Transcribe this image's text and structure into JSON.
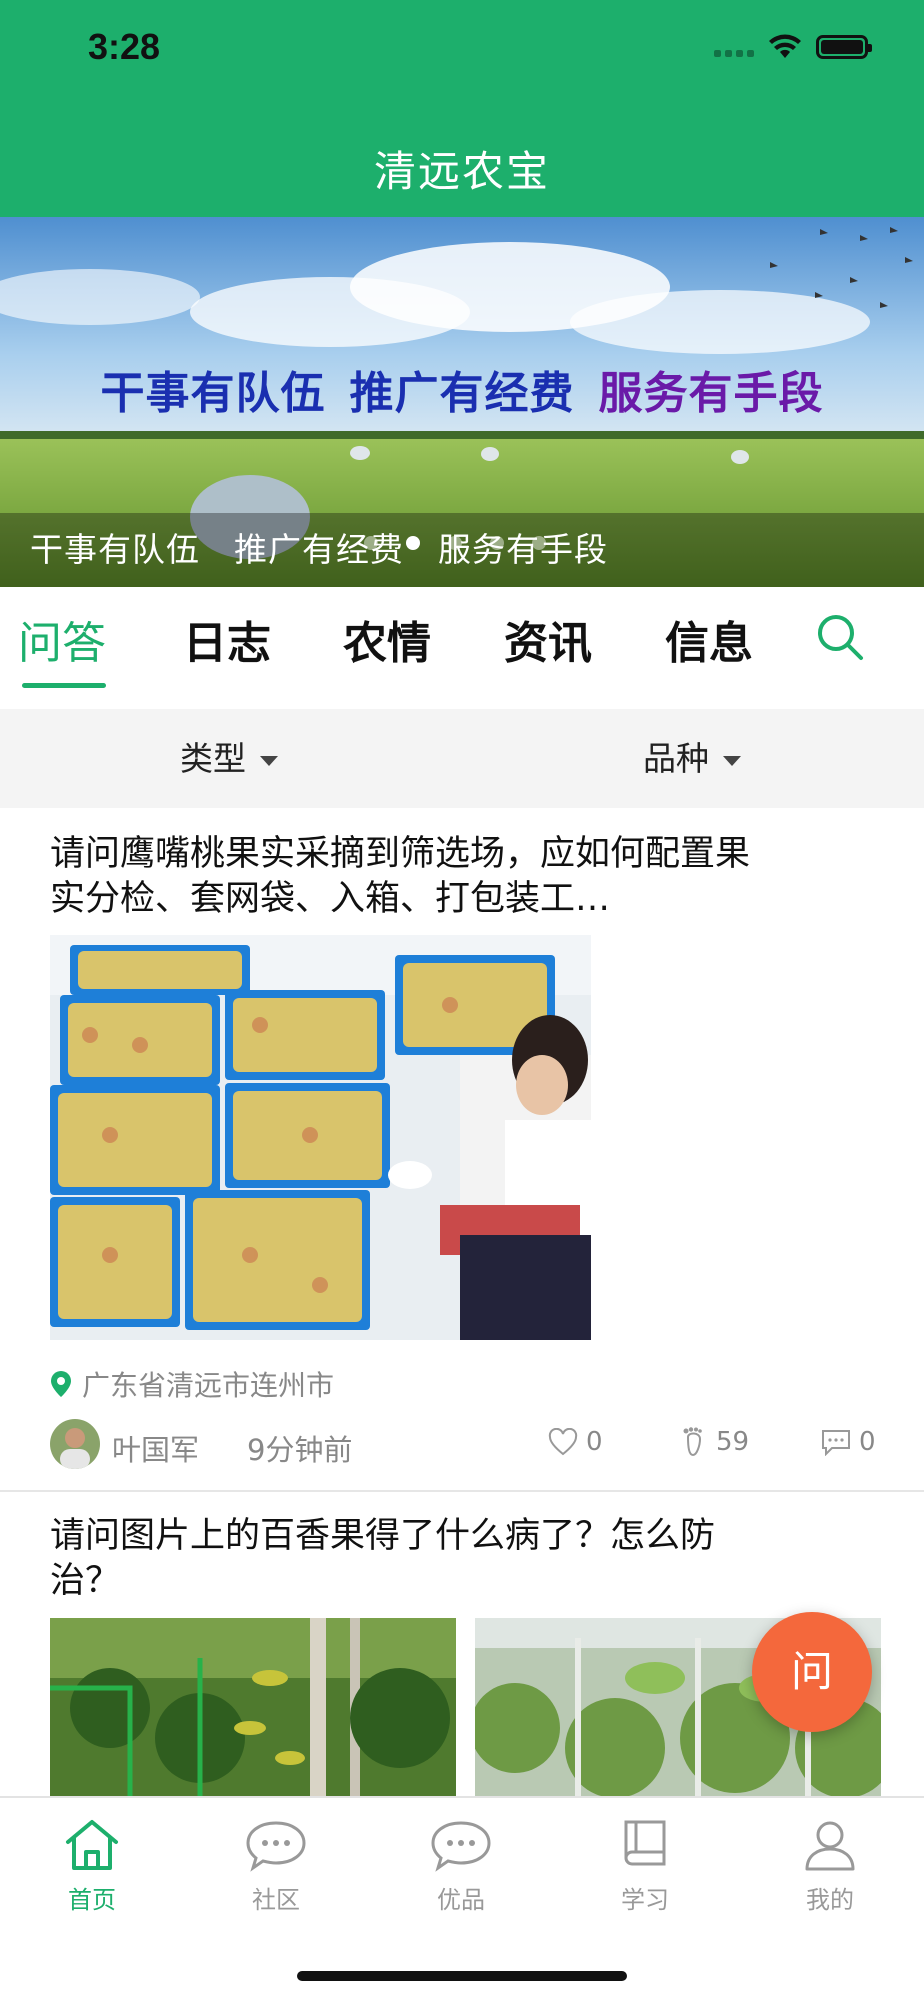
{
  "status_bar": {
    "time": "3:28"
  },
  "header": {
    "title": "清远农宝"
  },
  "banner": {
    "slogan_parts": [
      "干事有队伍",
      "推广有经费",
      "服务有手段"
    ],
    "caption": "干事有队伍　推广有经费　服务有手段",
    "slide_count": 5,
    "active_slide": 1
  },
  "tabs": {
    "items": [
      "问答",
      "日志",
      "农情",
      "资讯",
      "信息"
    ],
    "active": "问答"
  },
  "filters": {
    "type_label": "类型",
    "variety_label": "品种"
  },
  "posts": [
    {
      "title": "请问鹰嘴桃果实采摘到筛选场，应如何配置果实分检、套网袋、入箱、打包装工…",
      "location": "广东省清远市连州市",
      "author": "叶国军",
      "time": "9分钟前",
      "likes": "0",
      "views": "59",
      "comments": "0"
    },
    {
      "title": "请问图片上的百香果得了什么病了？怎么防治？"
    }
  ],
  "fab": {
    "label": "问"
  },
  "bottom_nav": {
    "items": [
      {
        "label": "首页",
        "icon": "home-icon"
      },
      {
        "label": "社区",
        "icon": "chat-bubble-icon"
      },
      {
        "label": "优品",
        "icon": "chat-bubble-icon"
      },
      {
        "label": "学习",
        "icon": "book-icon"
      },
      {
        "label": "我的",
        "icon": "user-icon"
      }
    ],
    "active_index": 0
  },
  "colors": {
    "brand": "#1daf6c",
    "fab": "#f4683c"
  }
}
